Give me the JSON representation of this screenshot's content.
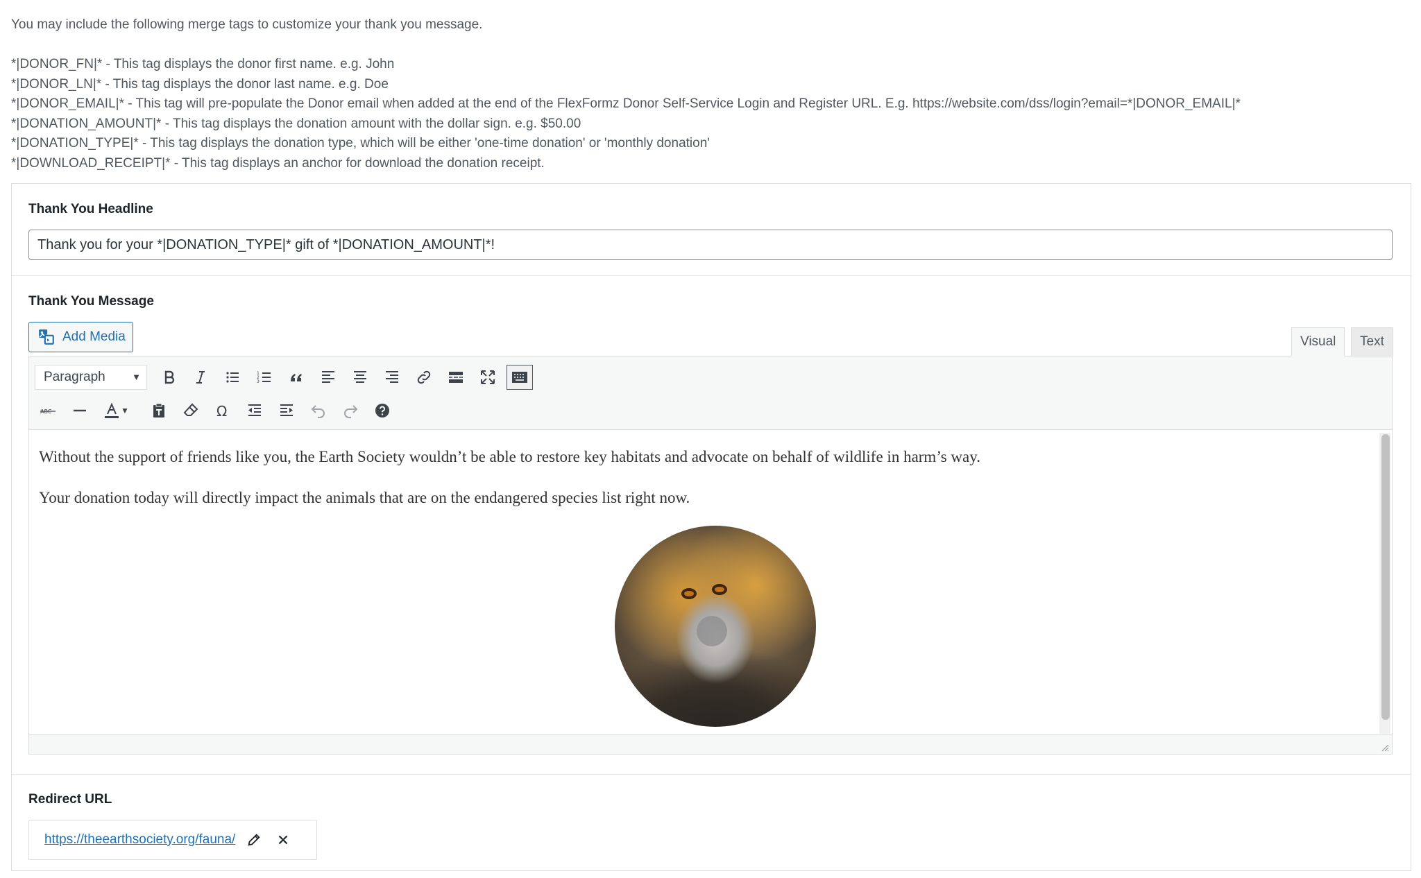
{
  "intro": {
    "lead": "You may include the following merge tags to customize your thank you message.",
    "tags": [
      "*|DONOR_FN|* - This tag displays the donor first name. e.g. John",
      "*|DONOR_LN|* - This tag displays the donor last name. e.g. Doe",
      "*|DONOR_EMAIL|* - This tag will pre-populate the Donor email when added at the end of the FlexFormz Donor Self-Service Login and Register URL. E.g. https://website.com/dss/login?email=*|DONOR_EMAIL|*",
      "*|DONATION_AMOUNT|* - This tag displays the donation amount with the dollar sign. e.g. $50.00",
      "*|DONATION_TYPE|* - This tag displays the donation type, which will be either 'one-time donation' or 'monthly donation'",
      "*|DOWNLOAD_RECEIPT|* - This tag displays an anchor for download the donation receipt."
    ]
  },
  "headline": {
    "label": "Thank You Headline",
    "value": "Thank you for your *|DONATION_TYPE|* gift of *|DONATION_AMOUNT|*!"
  },
  "message": {
    "label": "Thank You Message",
    "add_media": "Add Media",
    "tabs": {
      "visual": "Visual",
      "text": "Text"
    },
    "format": "Paragraph",
    "paragraphs": [
      "Without the support of friends like you, the Earth Society wouldn’t be able to restore key habitats and advocate on behalf of wildlife in harm’s way.",
      "Your donation today will directly impact the animals that are on the endangered species list right now."
    ],
    "toolbar_row1": [
      "bold-icon",
      "italic-icon",
      "bullet-list-icon",
      "numbered-list-icon",
      "blockquote-icon",
      "align-left-icon",
      "align-center-icon",
      "align-right-icon",
      "link-icon",
      "read-more-icon",
      "fullscreen-icon",
      "toolbar-toggle-icon"
    ],
    "toolbar_row2": [
      "strikethrough-icon",
      "horizontal-line-icon",
      "text-color-icon",
      "paste-text-icon",
      "clear-formatting-icon",
      "special-character-icon",
      "outdent-icon",
      "indent-icon",
      "undo-icon",
      "redo-icon",
      "help-icon"
    ]
  },
  "redirect": {
    "label": "Redirect URL",
    "url": "https://theearthsociety.org/fauna/"
  },
  "colors": {
    "accent": "#2271b1",
    "border": "#dcdcde",
    "toolbar_bg": "#f6f7f7"
  }
}
